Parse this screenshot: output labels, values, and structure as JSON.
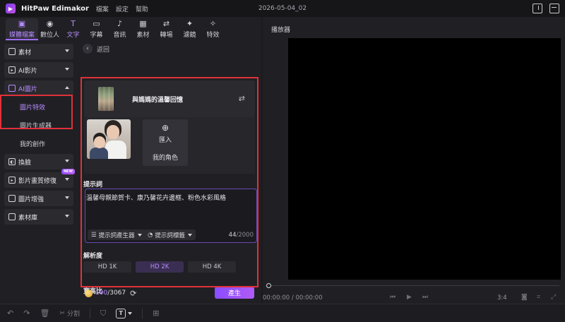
{
  "app": {
    "name": "HitPaw Edimakor",
    "menus": [
      "檔案",
      "設定",
      "幫助"
    ],
    "document_title": "2026-05-04_02"
  },
  "tabs": [
    {
      "label": "媒體檔案",
      "icon": "media-icon"
    },
    {
      "label": "數位人",
      "icon": "avatar-icon"
    },
    {
      "label": "文字",
      "icon": "text-icon"
    },
    {
      "label": "字幕",
      "icon": "subtitle-icon"
    },
    {
      "label": "音訊",
      "icon": "audio-icon"
    },
    {
      "label": "素材",
      "icon": "asset-icon"
    },
    {
      "label": "轉場",
      "icon": "transition-icon"
    },
    {
      "label": "濾鏡",
      "icon": "filter-icon"
    },
    {
      "label": "特效",
      "icon": "effect-icon"
    }
  ],
  "sidebar": {
    "items": [
      {
        "label": "素材"
      },
      {
        "label": "AI影片"
      },
      {
        "label": "AI圖片",
        "sub": [
          "圖片特效",
          "圖片生成器",
          "我的創作"
        ]
      },
      {
        "label": "換臉"
      },
      {
        "label": "影片畫質修復",
        "badge": "NEW"
      },
      {
        "label": "圖片增強"
      },
      {
        "label": "素材庫"
      }
    ]
  },
  "panel": {
    "back_label": "返回",
    "template_name": "與媽媽的溫馨回憶",
    "import_label": "匯入",
    "my_role_label": "我的角色",
    "prompt_label": "提示詞",
    "prompt_text": "溫馨母親節賀卡、康乃馨花卉邊框、粉色水彩風格",
    "prompt_generator": "提示詞產生器",
    "prompt_tags": "提示詞標籤",
    "char_count": "44",
    "char_max": "/2000",
    "resolution_label": "解析度",
    "resolutions": [
      "HD 1K",
      "HD 2K",
      "HD 4K"
    ],
    "selected_resolution": "HD 2K",
    "ratio_label": "寬高比",
    "credits_used": "100",
    "credits_total": "/3067",
    "generate_label": "產生"
  },
  "player": {
    "title": "播放器",
    "timecode": "00:00:00 / 00:00:00",
    "aspect": "3:4"
  },
  "toolbar": {
    "split_label": "分割",
    "text_glyph": "T"
  },
  "colors": {
    "accent": "#9d6cff",
    "highlight_box": "#e0313a"
  }
}
